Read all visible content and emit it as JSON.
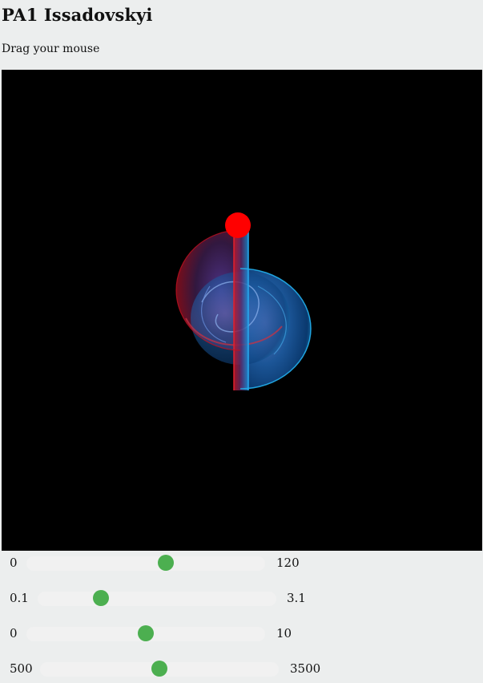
{
  "header": {
    "title": "PA1 Issadovskyi",
    "instruction": "Drag your mouse"
  },
  "colors": {
    "page_background": "#eceeee",
    "canvas_background": "#000000",
    "slider_track": "#f1f1f1",
    "slider_thumb": "#4caf50",
    "marker": "#ff0000"
  },
  "sliders": [
    {
      "min_label": "0",
      "max_label": "120",
      "min": 0,
      "max": 120,
      "value": 70
    },
    {
      "min_label": "0.1",
      "max_label": "3.1",
      "min": 0.1,
      "max": 3.1,
      "value": 0.9
    },
    {
      "min_label": "0",
      "max_label": "10",
      "min": 0,
      "max": 10,
      "value": 5
    },
    {
      "min_label": "500",
      "max_label": "3500",
      "min": 500,
      "max": 3500,
      "value": 2000
    }
  ]
}
